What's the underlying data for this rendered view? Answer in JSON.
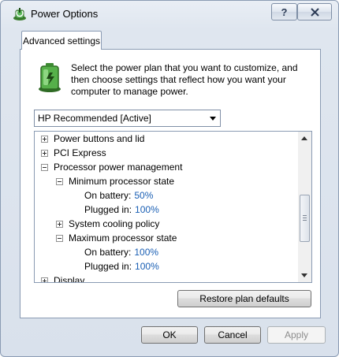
{
  "window": {
    "title": "Power Options",
    "help_label": "?",
    "close_label": "X"
  },
  "tab": {
    "label": "Advanced settings"
  },
  "description": "Select the power plan that you want to customize, and then choose settings that reflect how you want your computer to manage power.",
  "plan_select": {
    "value": "HP Recommended [Active]"
  },
  "tree": {
    "items": [
      {
        "label": "Power buttons and lid",
        "state": "collapsed"
      },
      {
        "label": "PCI Express",
        "state": "collapsed"
      },
      {
        "label": "Processor power management",
        "state": "expanded"
      },
      {
        "label": "Minimum processor state",
        "state": "expanded"
      },
      {
        "label": "On battery:",
        "value": "50%"
      },
      {
        "label": "Plugged in:",
        "value": "100%"
      },
      {
        "label": "System cooling policy",
        "state": "collapsed"
      },
      {
        "label": "Maximum processor state",
        "state": "expanded"
      },
      {
        "label": "On battery:",
        "value": "100%"
      },
      {
        "label": "Plugged in:",
        "value": "100%"
      },
      {
        "label": "Display",
        "state": "collapsed"
      }
    ]
  },
  "buttons": {
    "restore": "Restore plan defaults",
    "ok": "OK",
    "cancel": "Cancel",
    "apply": "Apply"
  },
  "colors": {
    "setting_value": "#1a5fb4",
    "window_bg": "#d9e1ec"
  }
}
